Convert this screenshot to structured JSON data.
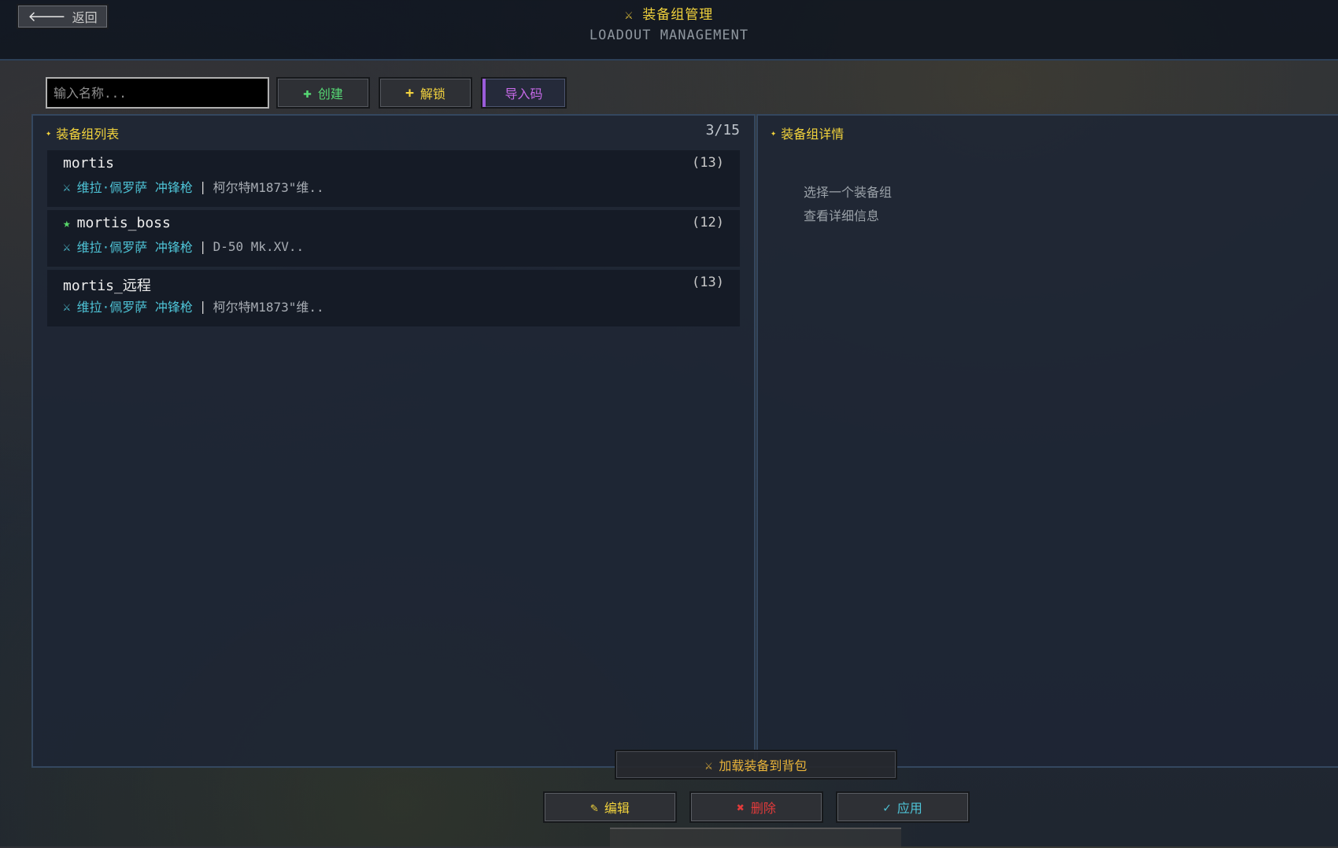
{
  "header": {
    "back_label": "返回",
    "title_zh": "装备组管理",
    "title_en": "LOADOUT MANAGEMENT"
  },
  "toolbar": {
    "name_placeholder": "输入名称...",
    "create_label": "创建",
    "unlock_label": "解锁",
    "import_label": "导入码"
  },
  "list_panel": {
    "title": "装备组列表",
    "count": "3/15",
    "entries": [
      {
        "name": "mortis",
        "count": "(13)",
        "primary": "维拉·佩罗萨 冲锋枪",
        "separator": "|",
        "secondary": "柯尔特M1873\"维..",
        "favorite": false
      },
      {
        "name": "mortis_boss",
        "count": "(12)",
        "primary": "维拉·佩罗萨 冲锋枪",
        "separator": "|",
        "secondary": "D-50 Mk.XV..",
        "favorite": true
      },
      {
        "name": "mortis_远程",
        "count": "(13)",
        "primary": "维拉·佩罗萨 冲锋枪",
        "separator": "|",
        "secondary": "柯尔特M1873\"维..",
        "favorite": false
      }
    ]
  },
  "detail_panel": {
    "title": "装备组详情",
    "hint_line1": "选择一个装备组",
    "hint_line2": "查看详细信息"
  },
  "actions": {
    "load_label": "加载装备到背包",
    "edit_label": "编辑",
    "delete_label": "删除",
    "apply_label": "应用"
  },
  "icons": {
    "title": "swords-icon",
    "back": "arrow-left-icon",
    "create": "plus-icon",
    "favorite": "star-icon"
  },
  "colors": {
    "accent_yellow": "#f2d33c",
    "weapon_cyan": "#4ec3d6",
    "create_green": "#56d874",
    "import_purple": "#c66ae8",
    "delete_red": "#e23b3b"
  }
}
